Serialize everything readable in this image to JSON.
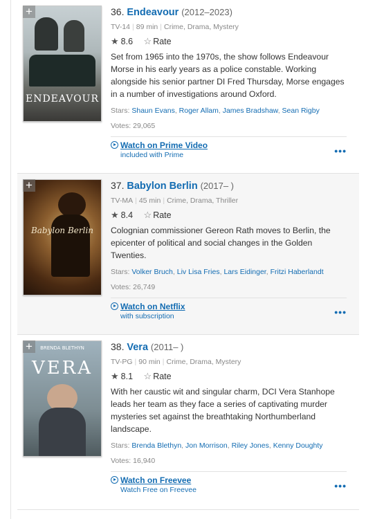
{
  "items": [
    {
      "add_symbol": "+",
      "index": "36.",
      "title": "Endeavour",
      "years": "(2012–2023)",
      "certificate": "TV-14",
      "runtime": "89 min",
      "genres": "Crime, Drama, Mystery",
      "rating": "8.6",
      "rate_label": "Rate",
      "plot": "Set from 1965 into the 1970s, the show follows Endeavour Morse in his early years as a police constable. Working alongside his senior partner DI Fred Thursday, Morse engages in a number of investigations around Oxford.",
      "stars_label": "Stars:",
      "stars": [
        "Shaun Evans",
        "Roger Allam",
        "James Bradshaw",
        "Sean Rigby"
      ],
      "votes_label": "Votes:",
      "votes": "29,065",
      "watch_title": "Watch on Prime Video",
      "watch_sub": "included with Prime",
      "poster_text": "ENDEAVOUR"
    },
    {
      "add_symbol": "+",
      "index": "37.",
      "title": "Babylon Berlin",
      "years": "(2017– )",
      "certificate": "TV-MA",
      "runtime": "45 min",
      "genres": "Crime, Drama, Thriller",
      "rating": "8.4",
      "rate_label": "Rate",
      "plot": "Colognian commissioner Gereon Rath moves to Berlin, the epicenter of political and social changes in the Golden Twenties.",
      "stars_label": "Stars:",
      "stars": [
        "Volker Bruch",
        "Liv Lisa Fries",
        "Lars Eidinger",
        "Fritzi Haberlandt"
      ],
      "votes_label": "Votes:",
      "votes": "26,749",
      "watch_title": "Watch on Netflix",
      "watch_sub": "with subscription",
      "poster_text": "Babylon Berlin"
    },
    {
      "add_symbol": "+",
      "index": "38.",
      "title": "Vera",
      "years": "(2011– )",
      "certificate": "TV-PG",
      "runtime": "90 min",
      "genres": "Crime, Drama, Mystery",
      "rating": "8.1",
      "rate_label": "Rate",
      "plot": "With her caustic wit and singular charm, DCI Vera Stanhope leads her team as they face a series of captivating murder mysteries set against the breathtaking Northumberland landscape.",
      "stars_label": "Stars:",
      "stars": [
        "Brenda Blethyn",
        "Jon Morrison",
        "Riley Jones",
        "Kenny Doughty"
      ],
      "votes_label": "Votes:",
      "votes": "16,940",
      "watch_title": "Watch on Freevee",
      "watch_sub": "Watch Free on Freevee",
      "poster_text": "VERA",
      "poster_top_text": "BRENDA BLETHYN"
    }
  ],
  "more_symbol": "•••",
  "colors": {
    "link": "#136cb2",
    "row_alt": "#f6f6f6"
  }
}
